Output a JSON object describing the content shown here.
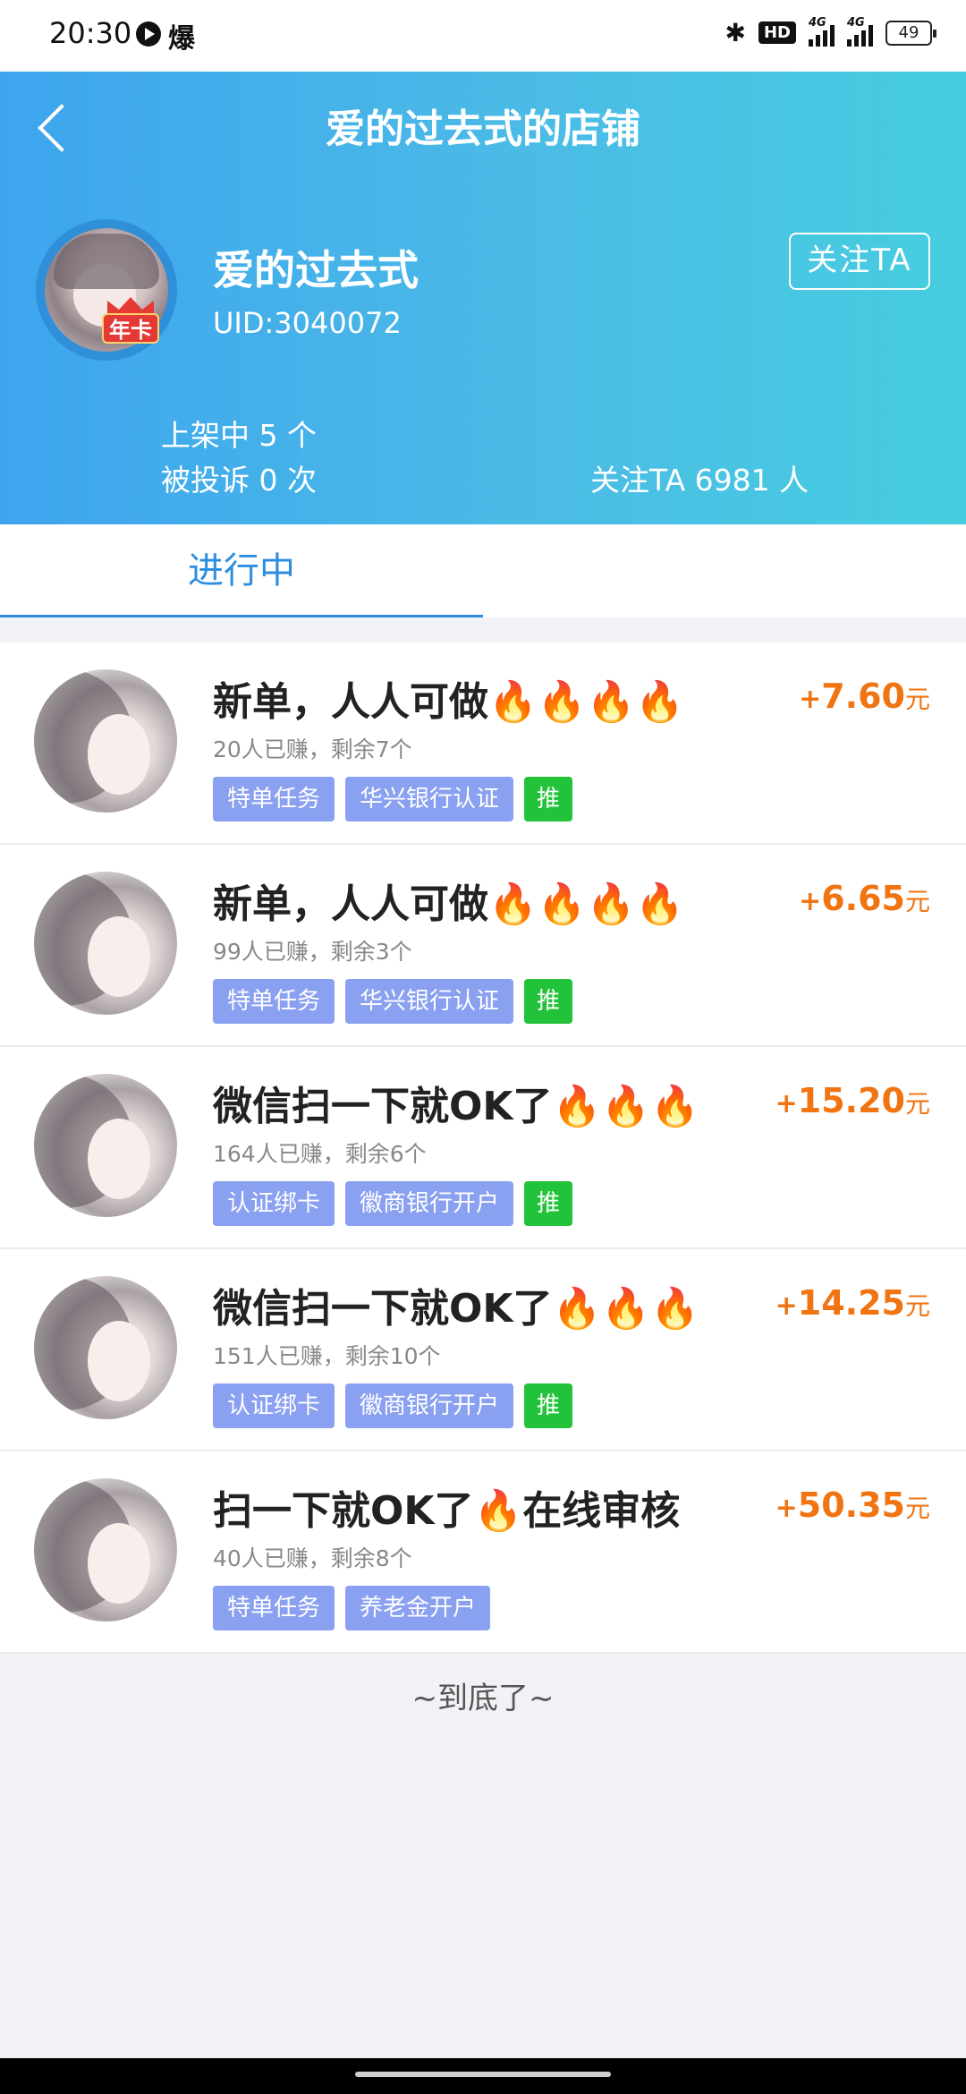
{
  "status_bar": {
    "time": "20:30",
    "app_icon": "爆",
    "battery": "49",
    "network": "4G",
    "hd": "HD"
  },
  "header": {
    "title": "爱的过去式的店铺",
    "shop_name": "爱的过去式",
    "uid": "UID:3040072",
    "badge": "年卡",
    "follow_button": "关注TA",
    "listed": "上架中 5 个",
    "complaints": "被投诉 0 次",
    "followers": "关注TA 6981 人",
    "gradient_start": "#3da5ee",
    "gradient_end": "#46cee0"
  },
  "tabs": [
    {
      "label": "进行中",
      "active": true
    }
  ],
  "tasks": [
    {
      "title": "新单，人人可做🔥🔥🔥🔥",
      "sub": "20人已赚，剩余7个",
      "tags": [
        "特单任务",
        "华兴银行认证"
      ],
      "push": "推",
      "plus": "+",
      "price": "7.60",
      "unit": "元"
    },
    {
      "title": "新单，人人可做🔥🔥🔥🔥",
      "sub": "99人已赚，剩余3个",
      "tags": [
        "特单任务",
        "华兴银行认证"
      ],
      "push": "推",
      "plus": "+",
      "price": "6.65",
      "unit": "元"
    },
    {
      "title": "微信扫一下就OK了🔥🔥🔥",
      "sub": "164人已赚，剩余6个",
      "tags": [
        "认证绑卡",
        "徽商银行开户"
      ],
      "push": "推",
      "plus": "+",
      "price": "15.20",
      "unit": "元"
    },
    {
      "title": "微信扫一下就OK了🔥🔥🔥",
      "sub": "151人已赚，剩余10个",
      "tags": [
        "认证绑卡",
        "徽商银行开户"
      ],
      "push": "推",
      "plus": "+",
      "price": "14.25",
      "unit": "元"
    },
    {
      "title": "扫一下就OK了🔥在线审核",
      "sub": "40人已赚，剩余8个",
      "tags": [
        "特单任务",
        "养老金开户"
      ],
      "push": "",
      "plus": "+",
      "price": "50.35",
      "unit": "元"
    }
  ],
  "footer": {
    "end_text": "~到底了~"
  },
  "colors": {
    "price": "#f07412",
    "tag": "#8aa0f0",
    "push_tag": "#22c33a",
    "tab_active": "#2d8ee0"
  }
}
